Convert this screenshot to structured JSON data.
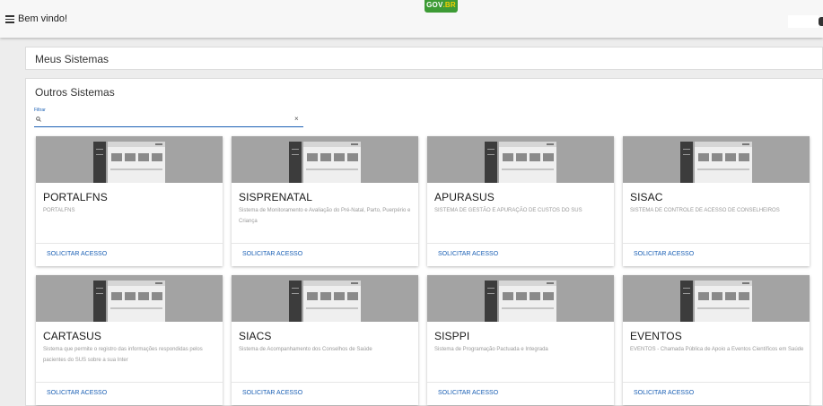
{
  "header": {
    "welcome": "Bem vindo!",
    "logo_gov": "GOV",
    "logo_br": ".BR"
  },
  "meus_sistemas": {
    "title": "Meus Sistemas"
  },
  "outros_sistemas": {
    "title": "Outros Sistemas",
    "filter": {
      "label": "Filtrar",
      "value": "",
      "placeholder": "",
      "clear": "×"
    }
  },
  "cards": [
    {
      "title": "PORTALFNS",
      "description": "PORTALFNS",
      "action": "SOLICITAR ACESSO"
    },
    {
      "title": "SISPRENATAL",
      "description": "Sistema de Monitoramento e Avaliação do Pré-Natal, Parto, Puerpério e Criança",
      "action": "SOLICITAR ACESSO"
    },
    {
      "title": "APURASUS",
      "description": "SISTEMA DE GESTÃO E APURAÇÃO DE CUSTOS DO SUS",
      "action": "SOLICITAR ACESSO"
    },
    {
      "title": "SISAC",
      "description": "SISTEMA DE CONTROLE DE ACESSO DE CONSELHEIROS",
      "action": "SOLICITAR ACESSO"
    },
    {
      "title": "CARTASUS",
      "description": "Sistema que permite o registro das informações respondidas pelos pacientes do SUS sobre a sua Inter",
      "action": "SOLICITAR ACESSO"
    },
    {
      "title": "SIACS",
      "description": "Sistema de Acompanhamento dos Conselhos de Saúde",
      "action": "SOLICITAR ACESSO"
    },
    {
      "title": "SISPPI",
      "description": "Sistema de Programação Pactuada e Integrada",
      "action": "SOLICITAR ACESSO"
    },
    {
      "title": "EVENTOS",
      "description": "EVENTOS - Chamada Pública de Apoio a Eventos Científicos em Saúde",
      "action": "SOLICITAR ACESSO"
    }
  ],
  "colors": {
    "accent": "#1a5fb4",
    "gov_green": "#3d9b35",
    "card_image_bg": "#a3a3a3",
    "page_bg": "#ededed"
  }
}
